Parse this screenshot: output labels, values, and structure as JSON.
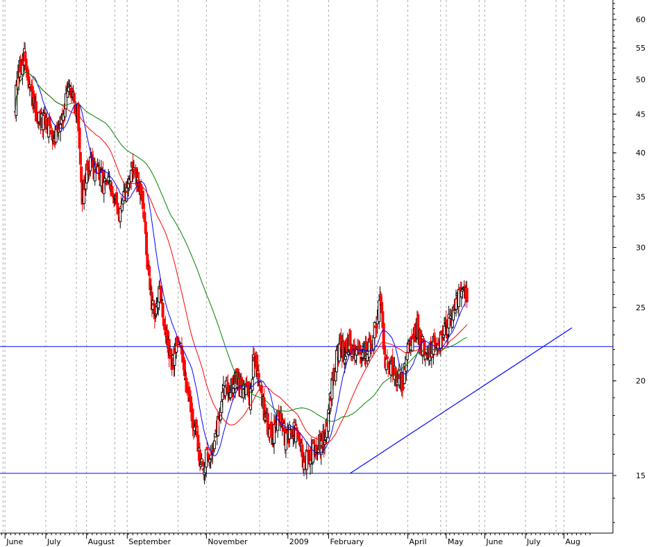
{
  "chart_data": {
    "type": "candlestick",
    "y_scale": "log",
    "ylim": [
      12,
      66
    ],
    "y_ticks": [
      15,
      20,
      25,
      30,
      35,
      40,
      45,
      50,
      55,
      60
    ],
    "y_tick_labels": [
      "15",
      "20",
      "25",
      "30",
      "35",
      "40",
      "45",
      "50",
      "55",
      "60"
    ],
    "x_labels": [
      "June",
      "July",
      "August",
      "September",
      "November",
      "2009",
      "February",
      "April",
      "May",
      "June",
      "July",
      "Aug"
    ],
    "x_label_weeks": [
      0.5,
      9.5,
      18.5,
      27.5,
      45.0,
      63.0,
      72.0,
      89.5,
      98.0,
      106.5,
      115.5,
      124.0
    ],
    "x_range_weeks": [
      -3,
      127
    ],
    "horizontal_lines": [
      {
        "value": 22.2,
        "color": "#0000ff"
      },
      {
        "value": 15.1,
        "color": "#0000ff"
      }
    ],
    "trendline": {
      "from": {
        "week": 74.0,
        "value": 15.1
      },
      "to": {
        "week": 123.0,
        "value": 23.5
      },
      "color": "#0000ff"
    },
    "ma_colors": {
      "short": "#0000ff",
      "medium": "#ff0000",
      "long": "#008000"
    },
    "up_color": "#000000",
    "down_color": "#ff0000",
    "closes": [
      46.0,
      50.5,
      54.0,
      50.0,
      46.5,
      45.0,
      43.5,
      44.0,
      43.0,
      42.5,
      44.0,
      46.0,
      48.0,
      47.0,
      45.0,
      35.0,
      37.5,
      38.5,
      38.0,
      37.0,
      36.5,
      36.0,
      34.5,
      33.5,
      34.0,
      36.0,
      38.5,
      36.5,
      35.0,
      31.0,
      26.0,
      24.0,
      27.0,
      24.0,
      22.0,
      21.0,
      23.0,
      21.5,
      20.0,
      18.5,
      17.0,
      16.0,
      15.5,
      16.0,
      16.5,
      17.5,
      19.0,
      20.0,
      19.5,
      20.5,
      19.5,
      20.0,
      19.0,
      21.5,
      20.5,
      18.5,
      17.5,
      17.0,
      18.0,
      17.5,
      16.8,
      17.0,
      17.2,
      16.5,
      15.5,
      15.8,
      16.3,
      16.5,
      16.5,
      17.5,
      19.5,
      21.0,
      22.5,
      21.5,
      22.5,
      22.0,
      21.5,
      21.8,
      22.0,
      22.5,
      23.5,
      25.5,
      21.0,
      20.8,
      20.5,
      20.2,
      20.0,
      22.0,
      23.0,
      23.5,
      22.5,
      22.0,
      21.8,
      22.5,
      22.5,
      23.0,
      24.0,
      24.5,
      25.5,
      26.5,
      26.0
    ]
  }
}
